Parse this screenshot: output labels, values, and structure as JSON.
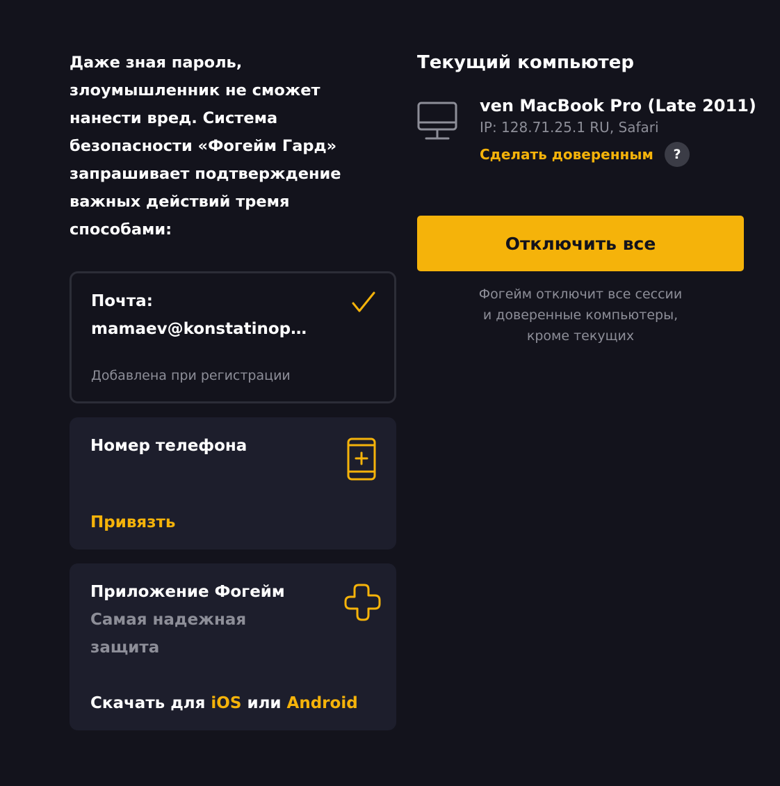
{
  "intro": {
    "text": "Даже зная пароль,\nзлоумышленник не сможет\nнанести вред. Система\nбезопасности «Фогейм Гард»\nзапрашивает подтверждение\nважных действий тремя\nспособами:"
  },
  "methods": {
    "mail": {
      "title": "Почта:",
      "email": "mamaev@konstatinop…",
      "note": "Добавлена при регистрации",
      "icon": "check-icon"
    },
    "phone": {
      "title": "Номер телефона",
      "action": "Привязть",
      "icon": "phone-plus-icon"
    },
    "app": {
      "title": "Приложение Фогейм",
      "subtitle": "Самая надежная защита",
      "download_prefix": "Скачать для",
      "ios": "iOS",
      "or": "или",
      "android": "Android",
      "icon": "plus-outline-icon"
    }
  },
  "current_computer": {
    "title": "Текущий компьютер",
    "device_name": "ven MacBook Pro (Late 2011)",
    "ip": "IP: 128.71.25.1 RU, Safari",
    "trust_link": "Сделать доверенным",
    "help": "?",
    "icon": "monitor-icon"
  },
  "disconnect": {
    "button": "Отключить все",
    "note": "Фогейм отключит все сессии\nи доверенные компьютеры,\nкроме текущих"
  },
  "colors": {
    "background": "#13131c",
    "card": "#1d1e2c",
    "accent": "#f5b30a",
    "muted": "#8d8e98"
  }
}
